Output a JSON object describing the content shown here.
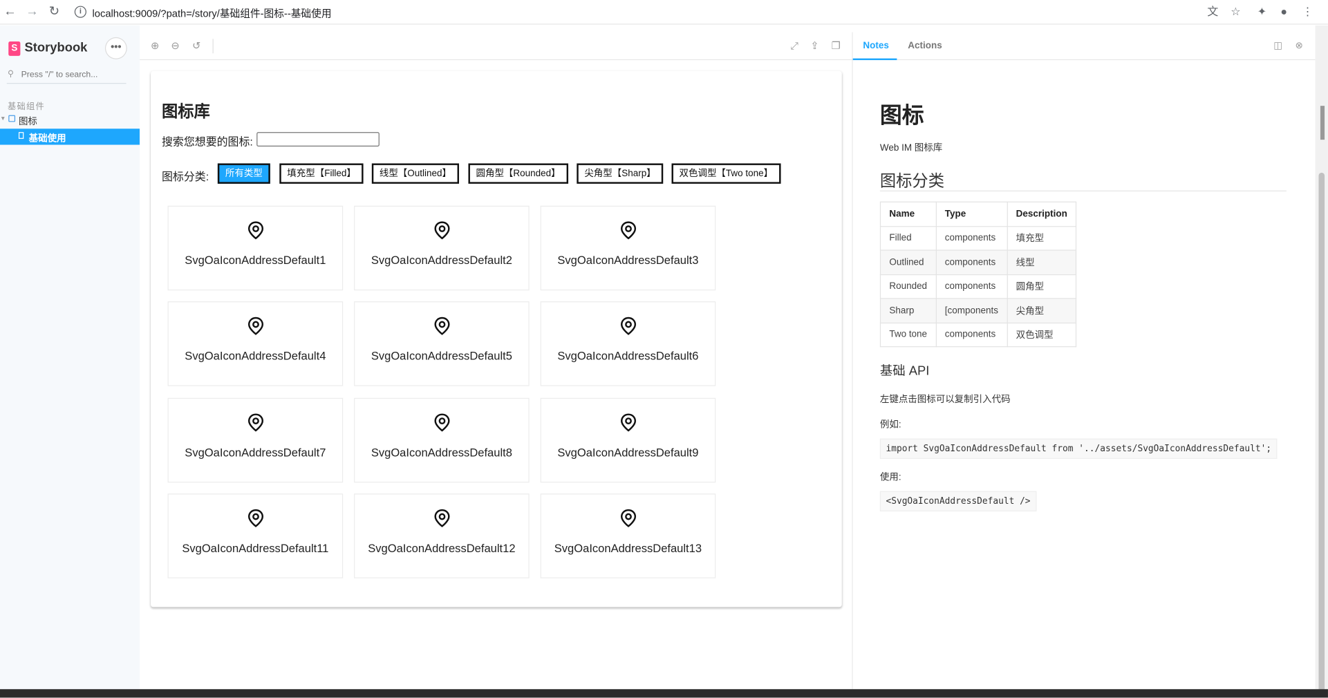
{
  "browser": {
    "url": "localhost:9009/?path=/story/基础组件-图标--基础使用",
    "icons": [
      "back-arrow-icon",
      "forward-arrow-icon",
      "reload-icon",
      "site-info-icon",
      "translate-icon",
      "star-icon",
      "extensions-icon",
      "profile-icon",
      "more-icon"
    ]
  },
  "sidebar": {
    "brand": "Storybook",
    "menu_glyph": "•••",
    "search_placeholder": "Press \"/\" to search...",
    "group_label": "基础组件",
    "items": [
      {
        "label": "图标",
        "kind": "component"
      },
      {
        "label": "基础使用",
        "kind": "story",
        "active": true
      }
    ]
  },
  "toolbar": {
    "icons": [
      "zoom-in-icon",
      "zoom-out-icon",
      "zoom-reset-icon",
      "fullscreen-icon",
      "share-icon",
      "copy-link-icon"
    ]
  },
  "preview": {
    "title": "图标库",
    "search_label": "搜索您想要的图标:",
    "search_value": "",
    "category_label": "图标分类:",
    "categories": [
      {
        "label": "所有类型",
        "active": true
      },
      {
        "label": "填充型【Filled】",
        "active": false
      },
      {
        "label": "线型【Outlined】",
        "active": false
      },
      {
        "label": "圆角型【Rounded】",
        "active": false
      },
      {
        "label": "尖角型【Sharp】",
        "active": false
      },
      {
        "label": "双色调型【Two tone】",
        "active": false
      }
    ],
    "icons": [
      "SvgOaIconAddressDefault1",
      "SvgOaIconAddressDefault2",
      "SvgOaIconAddressDefault3",
      "SvgOaIconAddressDefault4",
      "SvgOaIconAddressDefault5",
      "SvgOaIconAddressDefault6",
      "SvgOaIconAddressDefault7",
      "SvgOaIconAddressDefault8",
      "SvgOaIconAddressDefault9",
      "SvgOaIconAddressDefault11",
      "SvgOaIconAddressDefault12",
      "SvgOaIconAddressDefault13"
    ],
    "icon_glyph": "location-pin-icon"
  },
  "panel": {
    "tabs": [
      "Notes",
      "Actions"
    ],
    "active_tab": "Notes",
    "icons": [
      "panel-layout-icon",
      "close-panel-icon"
    ]
  },
  "notes": {
    "title": "图标",
    "subtitle": "Web IM 图标库",
    "section_title": "图标分类",
    "table": {
      "headers": [
        "Name",
        "Type",
        "Description"
      ],
      "rows": [
        [
          "Filled",
          "components",
          "填充型"
        ],
        [
          "Outlined",
          "components",
          "线型"
        ],
        [
          "Rounded",
          "components",
          "圆角型"
        ],
        [
          "Sharp",
          "[components",
          "尖角型"
        ],
        [
          "Two tone",
          "components",
          "双色调型"
        ]
      ]
    },
    "api_title": "基础 API",
    "api_desc": "左键点击图标可以复制引入代码",
    "example_label": "例如:",
    "import_code": "import SvgOaIconAddressDefault from '../assets/SvgOaIconAddressDefault';",
    "usage_label": "使用:",
    "usage_code": "<SvgOaIconAddressDefault />"
  },
  "colors": {
    "accent": "#1ea7fd",
    "storybook_pink": "#ff4785",
    "sidebar_bg": "#f6f9fc"
  }
}
